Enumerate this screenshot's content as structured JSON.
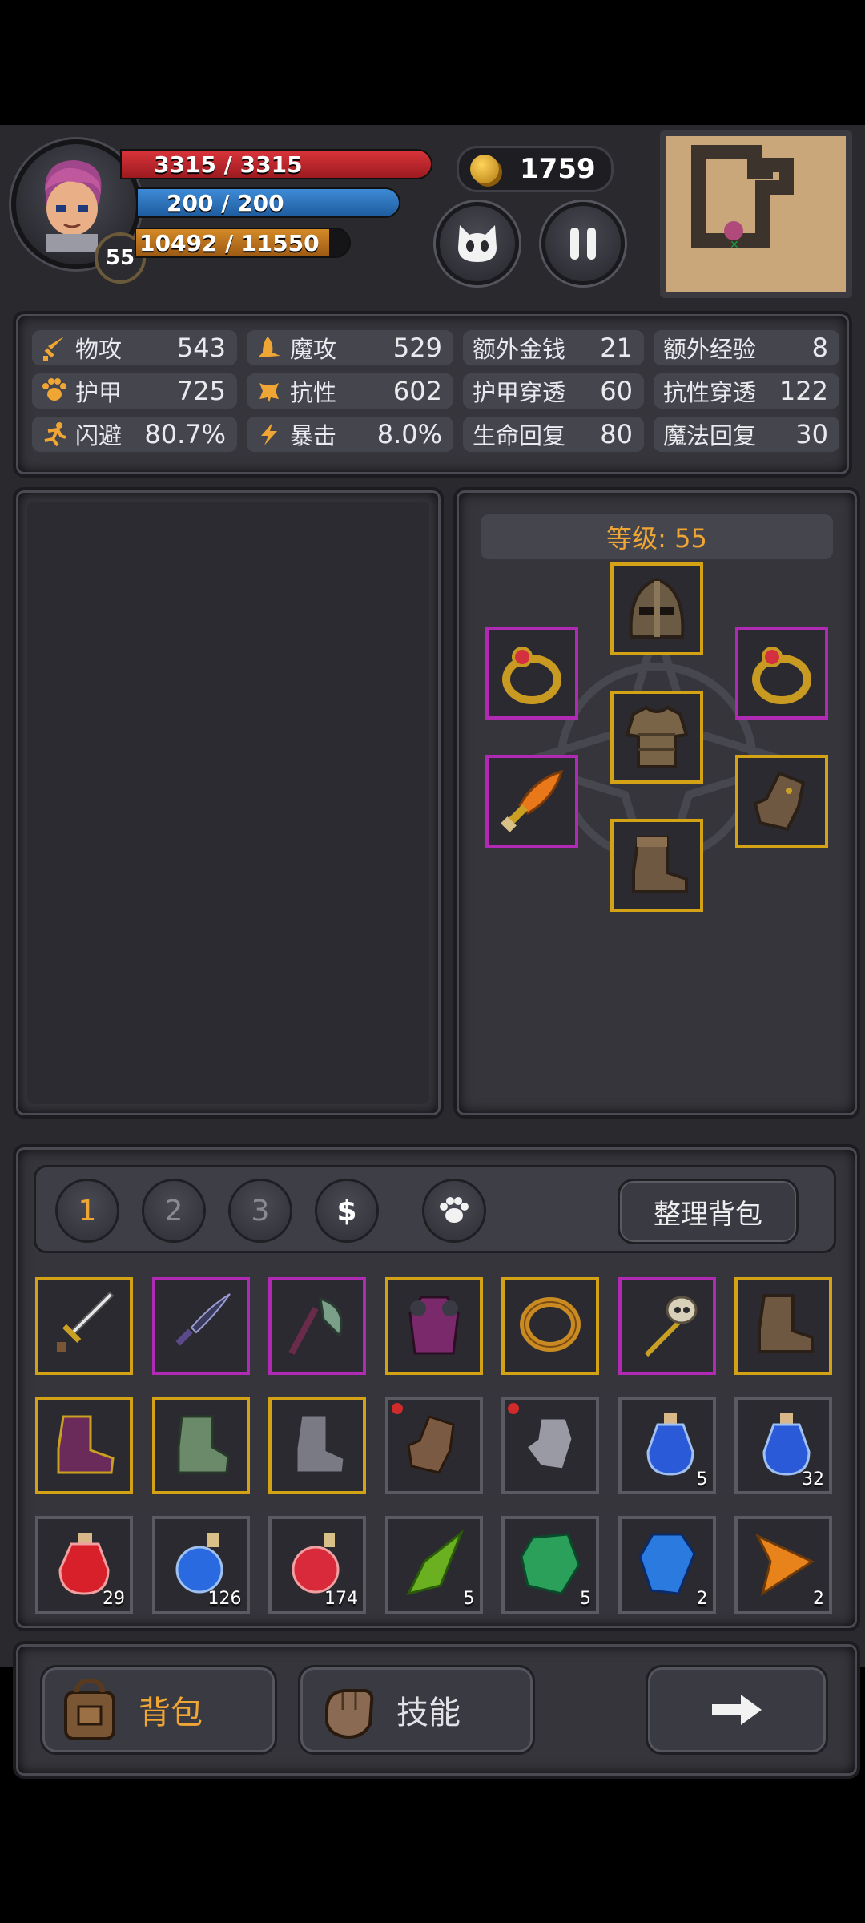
{
  "player": {
    "level": "55",
    "hp_text": "3315 / 3315",
    "mp_text": "200 / 200",
    "xp_text": "10492 / 11550",
    "xp_fraction": 0.906,
    "gold": "1759"
  },
  "stats": [
    {
      "label": "物攻",
      "value": "543",
      "icon": "sword-icon"
    },
    {
      "label": "魔攻",
      "value": "529",
      "icon": "wizard-hat-icon"
    },
    {
      "label": "额外金钱",
      "value": "21",
      "icon": ""
    },
    {
      "label": "额外经验",
      "value": "8",
      "icon": ""
    },
    {
      "label": "护甲",
      "value": "725",
      "icon": "paw-armor-icon"
    },
    {
      "label": "抗性",
      "value": "602",
      "icon": "muscle-icon"
    },
    {
      "label": "护甲穿透",
      "value": "60",
      "icon": ""
    },
    {
      "label": "抗性穿透",
      "value": "122",
      "icon": ""
    },
    {
      "label": "闪避",
      "value": "80.7%",
      "icon": "running-icon"
    },
    {
      "label": "暴击",
      "value": "8.0%",
      "icon": "lightning-icon"
    },
    {
      "label": "生命回复",
      "value": "80",
      "icon": ""
    },
    {
      "label": "魔法回复",
      "value": "30",
      "icon": ""
    }
  ],
  "equipment": {
    "level_title": "等级: 55",
    "slots": [
      "helmet-icon",
      "ring-icon",
      "ring-icon",
      "chest-armor-icon",
      "dagger-icon",
      "gauntlet-icon",
      "boots-icon"
    ]
  },
  "bag": {
    "tabs": [
      "1",
      "2",
      "3",
      "$",
      ""
    ],
    "sort_label": "整理背包",
    "items": [
      {
        "icon": "sword-icon",
        "qty": ""
      },
      {
        "icon": "dark-dagger-icon",
        "qty": ""
      },
      {
        "icon": "axe-icon",
        "qty": ""
      },
      {
        "icon": "robe-icon",
        "qty": ""
      },
      {
        "icon": "ring-icon",
        "qty": ""
      },
      {
        "icon": "skull-staff-icon",
        "qty": ""
      },
      {
        "icon": "boots-icon",
        "qty": ""
      },
      {
        "icon": "purple-boots-icon",
        "qty": ""
      },
      {
        "icon": "green-boots-icon",
        "qty": ""
      },
      {
        "icon": "iron-boots-icon",
        "qty": ""
      },
      {
        "icon": "leather-gloves-icon",
        "qty": ""
      },
      {
        "icon": "steel-gloves-icon",
        "qty": ""
      },
      {
        "icon": "blue-potion-icon",
        "qty": "5"
      },
      {
        "icon": "blue-potion-icon",
        "qty": "32"
      },
      {
        "icon": "red-potion-icon",
        "qty": "29"
      },
      {
        "icon": "blue-flask-icon",
        "qty": "126"
      },
      {
        "icon": "red-flask-icon",
        "qty": "174"
      },
      {
        "icon": "green-crystal-icon",
        "qty": "5"
      },
      {
        "icon": "green-gem-icon",
        "qty": "5"
      },
      {
        "icon": "blue-gem-icon",
        "qty": "2"
      },
      {
        "icon": "orange-gem-icon",
        "qty": "2"
      }
    ]
  },
  "bottom": {
    "bag_label": "背包",
    "skills_label": "技能"
  },
  "colors": {
    "gold_accent": "#f0a634",
    "rare_border": "#d4a215",
    "epic_border": "#b02ab4",
    "hp": "#d8343a",
    "mp": "#3e8ad6",
    "xp": "#d48a28"
  }
}
